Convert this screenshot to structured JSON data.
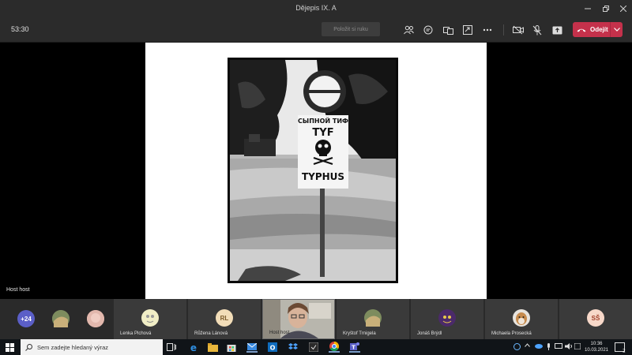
{
  "window": {
    "title": "Dějepis IX. A",
    "controls": [
      "minimize-icon",
      "restore-icon",
      "close-icon"
    ]
  },
  "toolbar": {
    "timer": "53:30",
    "raise_hand_label": "Položit si ruku",
    "leave_label": "Odejít",
    "accent_leave": "#c4314b",
    "icons": [
      "people-icon",
      "chat-icon",
      "rooms-icon",
      "share-tray-icon",
      "more-icon",
      "camera-off-icon",
      "mic-off-icon",
      "share-icon"
    ]
  },
  "stage": {
    "presenter_label": "Host host",
    "slide_image": {
      "sign_lines": [
        "СЫПНОЙ ТИФ",
        "TYF",
        "TYPHUS"
      ]
    }
  },
  "participants": {
    "overflow_count": "+24",
    "tiles": [
      {
        "name": "",
        "kind": "photo"
      },
      {
        "name": "",
        "kind": "photo"
      },
      {
        "name": "Lenka Plchová",
        "kind": "photo"
      },
      {
        "name": "Růžena Lánová",
        "initials": "RL",
        "kind": "initials"
      },
      {
        "name": "Host host",
        "kind": "video"
      },
      {
        "name": "Kryštof Trnigela",
        "kind": "photo"
      },
      {
        "name": "Jonáš Brýdl",
        "kind": "photo"
      },
      {
        "name": "Michaela Prosecká",
        "kind": "photo"
      },
      {
        "name": "",
        "initials": "SŠ",
        "kind": "initials"
      }
    ]
  },
  "taskbar": {
    "search_placeholder": "Sem zadejte hledaný výraz",
    "time": "10:36",
    "date": "10.03.2021",
    "notification_count": "2"
  }
}
